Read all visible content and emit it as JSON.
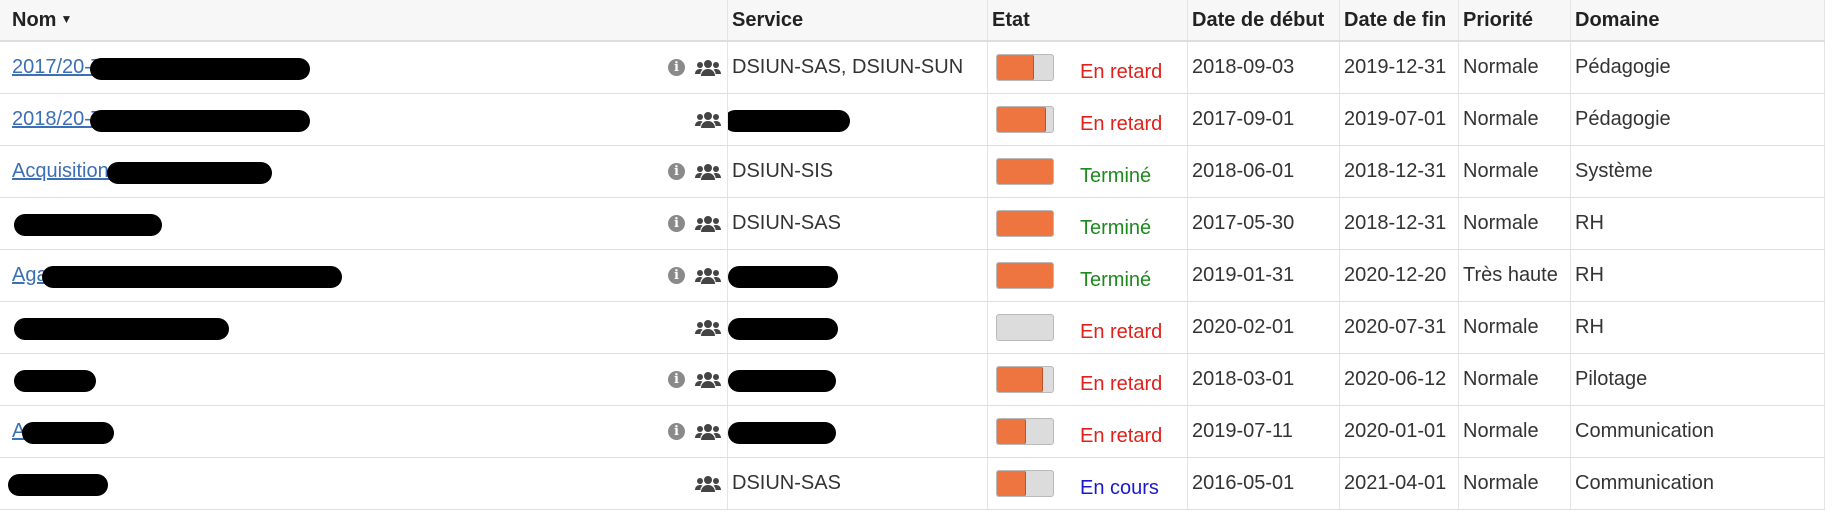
{
  "columns": {
    "nom": "Nom",
    "service": "Service",
    "etat": "Etat",
    "debut": "Date de début",
    "fin": "Date de fin",
    "priorite": "Priorité",
    "domaine": "Domaine"
  },
  "sort_indicator": "caret-down-icon",
  "colors": {
    "link": "#3b6fb6",
    "progress_fill": "#ee7440",
    "status_late": "#e0201b",
    "status_done": "#1e8a1e",
    "status_ongoing": "#1a1acc"
  },
  "rows": [
    {
      "name": "2017/20-TICE-DEC",
      "service": "DSIUN-SAS, DSIUN-SUN",
      "progress": 0.65,
      "status": "En retard",
      "status_kind": "late",
      "start": "2018-09-03",
      "end": "2019-12-31",
      "priority": "Normale",
      "domain": "Pédagogie",
      "has_info": true
    },
    {
      "name": "2018/20-TICE",
      "service": "",
      "progress": 0.85,
      "status": "En retard",
      "status_kind": "late",
      "start": "2017-09-01",
      "end": "2019-07-01",
      "priority": "Normale",
      "domain": "Pédagogie",
      "has_info": false
    },
    {
      "name": "Acquisition d",
      "service": "DSIUN-SIS",
      "progress": 1.0,
      "status": "Terminé",
      "status_kind": "done",
      "start": "2018-06-01",
      "end": "2018-12-31",
      "priority": "Normale",
      "domain": "Système",
      "has_info": true
    },
    {
      "name": "",
      "service": "DSIUN-SAS",
      "progress": 1.0,
      "status": "Terminé",
      "status_kind": "done",
      "start": "2017-05-30",
      "end": "2018-12-31",
      "priority": "Normale",
      "domain": "RH",
      "has_info": true
    },
    {
      "name": "Aga",
      "service": "",
      "progress": 1.0,
      "status": "Terminé",
      "status_kind": "done",
      "start": "2019-01-31",
      "end": "2020-12-20",
      "priority": "Très haute",
      "domain": "RH",
      "has_info": true
    },
    {
      "name": "",
      "service": "",
      "progress": 0.0,
      "status": "En retard",
      "status_kind": "late",
      "start": "2020-02-01",
      "end": "2020-07-31",
      "priority": "Normale",
      "domain": "RH",
      "has_info": false
    },
    {
      "name": "",
      "service": "",
      "progress": 0.8,
      "status": "En retard",
      "status_kind": "late",
      "start": "2018-03-01",
      "end": "2020-06-12",
      "priority": "Normale",
      "domain": "Pilotage",
      "has_info": true
    },
    {
      "name": "A",
      "service": "",
      "progress": 0.5,
      "status": "En retard",
      "status_kind": "late",
      "start": "2019-07-11",
      "end": "2020-01-01",
      "priority": "Normale",
      "domain": "Communication",
      "has_info": true
    },
    {
      "name": "",
      "service": "DSIUN-SAS",
      "progress": 0.5,
      "status": "En cours",
      "status_kind": "ongoing",
      "start": "2016-05-01",
      "end": "2021-04-01",
      "priority": "Normale",
      "domain": "Communication",
      "has_info": false
    }
  ]
}
